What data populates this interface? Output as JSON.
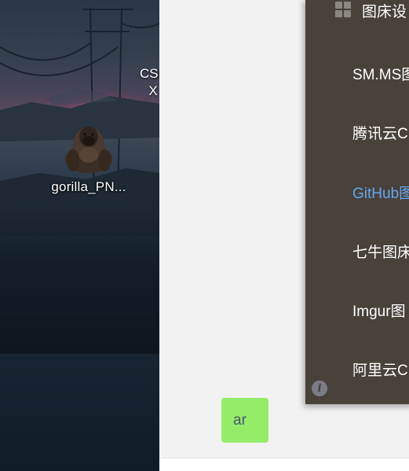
{
  "desktop": {
    "icons": [
      {
        "label": "gorilla_PN...",
        "icon": "gorilla-image-icon"
      }
    ],
    "partial_icon_label_line1": "CSF",
    "partial_icon_label_line2": "X"
  },
  "menu": {
    "header": {
      "icon": "grid-icon",
      "title": "图床设"
    },
    "items": [
      {
        "label": "SM.MS图",
        "active": false
      },
      {
        "label": "腾讯云C",
        "active": false
      },
      {
        "label": "GitHub图",
        "active": true
      },
      {
        "label": "七牛图床",
        "active": false
      },
      {
        "label": "Imgur图",
        "active": false
      },
      {
        "label": "阿里云C",
        "active": false
      }
    ],
    "footer_icon": "info-icon",
    "footer_glyph": "i"
  },
  "chat": {
    "bubble_text": "ar"
  },
  "colors": {
    "menu_bg": "#48423b",
    "menu_active": "#66a6f0",
    "bubble": "#95ec69"
  }
}
